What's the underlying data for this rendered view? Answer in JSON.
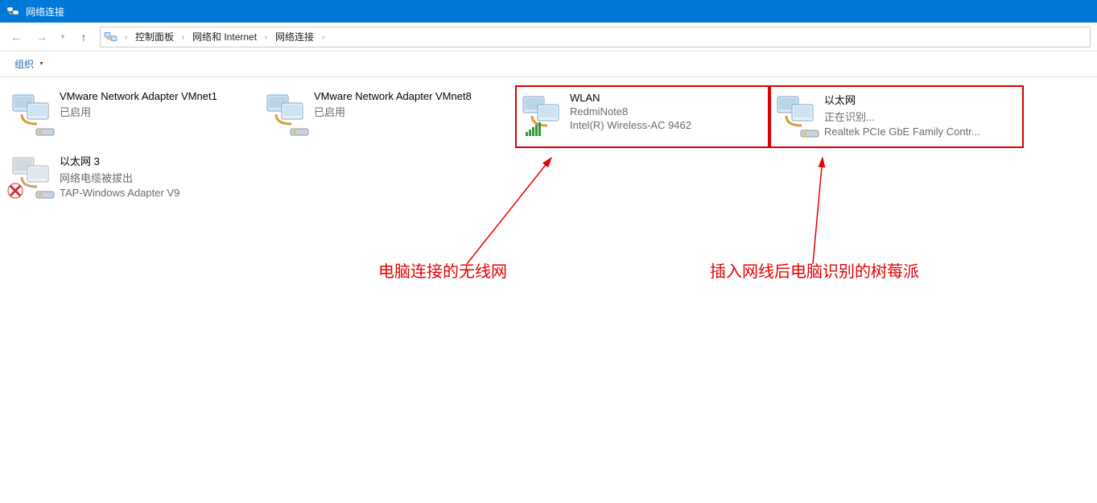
{
  "window": {
    "title": "网络连接"
  },
  "breadcrumb": {
    "items": [
      "控制面板",
      "网络和 Internet",
      "网络连接"
    ]
  },
  "toolbar": {
    "organize": "组织"
  },
  "adapters": [
    {
      "name": "VMware Network Adapter VMnet1",
      "status": "已启用",
      "device": ""
    },
    {
      "name": "VMware Network Adapter VMnet8",
      "status": "已启用",
      "device": ""
    },
    {
      "name": "WLAN",
      "status": "RedmiNote8",
      "device": "Intel(R) Wireless-AC 9462"
    },
    {
      "name": "以太网",
      "status": "正在识别...",
      "device": "Realtek PCIe GbE Family Contr..."
    },
    {
      "name": "以太网 3",
      "status": "网络电缆被拔出",
      "device": "TAP-Windows Adapter V9"
    }
  ],
  "annotations": {
    "wifi": "电脑连接的无线网",
    "ethernet": "插入网线后电脑识别的树莓派"
  },
  "colors": {
    "titlebar": "#0078d7",
    "annotation": "#e60000",
    "highlight_border": "#d80000"
  }
}
